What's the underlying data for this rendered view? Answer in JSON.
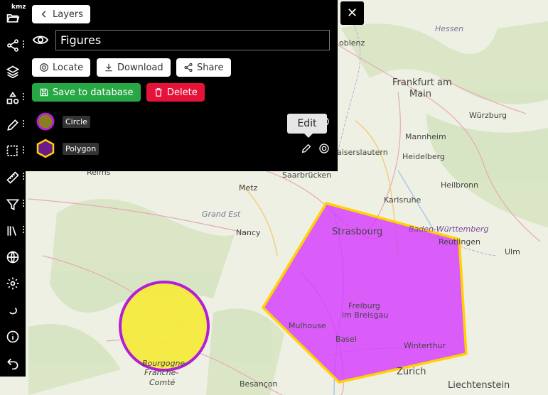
{
  "map": {
    "labels": {
      "hessen": "Hessen",
      "koblenz": "oblenz",
      "frankfurt1": "Frankfurt am",
      "frankfurt2": "Main",
      "wurzburg": "Würzburg",
      "mannheim": "Mannheim",
      "kaiserslautern": "aiserslautern",
      "heidelberg": "Heidelberg",
      "reims": "Reims",
      "saarbrucken": "Saarbrücken",
      "heilbronn": "Heilbronn",
      "metz": "Metz",
      "karlsruhe": "Karlsruhe",
      "grand_est": "Grand Est",
      "strasbourg": "Strasbourg",
      "baden": "Baden-Württemberg",
      "reutlingen": "Reutlingen",
      "nancy": "Nancy",
      "ulm": "Ulm",
      "freiburg1": "Freiburg",
      "freiburg2": "im Breisgau",
      "mulhouse": "Mulhouse",
      "basel": "Basel",
      "winterthur": "Winterthur",
      "bourgogne1": "Bourgogne-",
      "bourgogne2": "Franche-",
      "bourgogne3": "Comté",
      "zurich": "Zurich",
      "besancon": "Besançon",
      "liechtenstein": "Liechtenstein"
    },
    "colors": {
      "shape_fill": "#d633ff",
      "shape_stroke": "#ffd700",
      "circle_fill": "#f5ea3a",
      "circle_stroke": "#b31ed6"
    }
  },
  "toolbar": {
    "kmz": "kmz",
    "tools": [
      "folder-open-icon",
      "share-nodes-icon",
      "layers-icon",
      "shapes-icon",
      "pencil-icon",
      "select-area-icon",
      "ruler-icon",
      "filter-icon",
      "library-icon",
      "globe-icon",
      "settings-icon",
      "redo-icon",
      "info-icon",
      "undo-icon"
    ]
  },
  "panel": {
    "back_label": "Layers",
    "name_value": "Figures",
    "locate_label": "Locate",
    "download_label": "Download",
    "share_label": "Share",
    "save_label": "Save to database",
    "delete_label": "Delete",
    "layers": [
      {
        "name": "Circle",
        "icon": "circle-swatch-icon"
      },
      {
        "name": "Polygon",
        "icon": "hexagon-swatch-icon"
      }
    ],
    "tooltip": "Edit"
  }
}
